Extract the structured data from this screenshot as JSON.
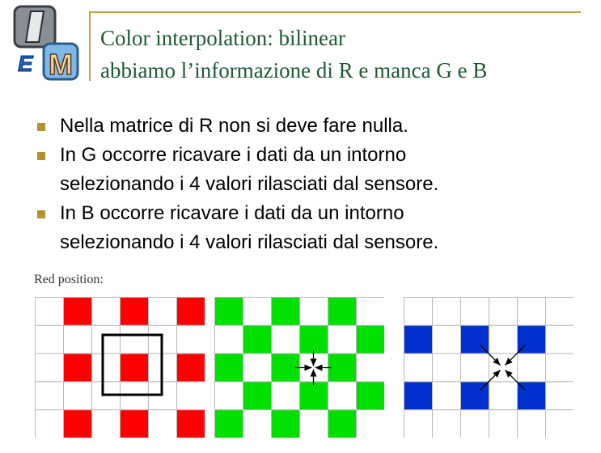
{
  "title": {
    "line1": "Color interpolation: bilinear",
    "line2": "abbiamo l’informazione di R e manca G e B"
  },
  "logo": {
    "letters": [
      "I",
      "E",
      "M"
    ]
  },
  "bullets": [
    "Nella matrice di R non si deve fare nulla.",
    "In G occorre ricavare i dati da un intorno\nselezionando i 4 valori rilasciati dal sensore.",
    "In B occorre ricavare i dati da un intorno\nselezionando i 4 valori rilasciati dal sensore."
  ],
  "caption": "Red position:",
  "colors": {
    "red": "#ff0000",
    "green": "#00e000",
    "blue": "#0030d0",
    "bullet": "#b39230",
    "title": "#1e5a32",
    "rule": "#c8a040"
  },
  "grids": {
    "rows": 5,
    "cols": 6,
    "red_pattern": [
      [
        0,
        1,
        0,
        1,
        0,
        1
      ],
      [
        0,
        0,
        0,
        0,
        0,
        0
      ],
      [
        0,
        1,
        0,
        1,
        0,
        1
      ],
      [
        0,
        0,
        0,
        0,
        0,
        0
      ],
      [
        0,
        1,
        0,
        1,
        0,
        1
      ]
    ],
    "green_pattern": [
      [
        1,
        0,
        1,
        0,
        1,
        0
      ],
      [
        0,
        1,
        0,
        1,
        0,
        1
      ],
      [
        1,
        0,
        1,
        0,
        1,
        0
      ],
      [
        0,
        1,
        0,
        1,
        0,
        1
      ],
      [
        1,
        0,
        1,
        0,
        1,
        0
      ]
    ],
    "blue_pattern": [
      [
        0,
        0,
        0,
        0,
        0,
        0
      ],
      [
        1,
        0,
        1,
        0,
        1,
        0
      ],
      [
        0,
        0,
        0,
        0,
        0,
        0
      ],
      [
        1,
        0,
        1,
        0,
        1,
        0
      ],
      [
        0,
        0,
        0,
        0,
        0,
        0
      ]
    ]
  }
}
